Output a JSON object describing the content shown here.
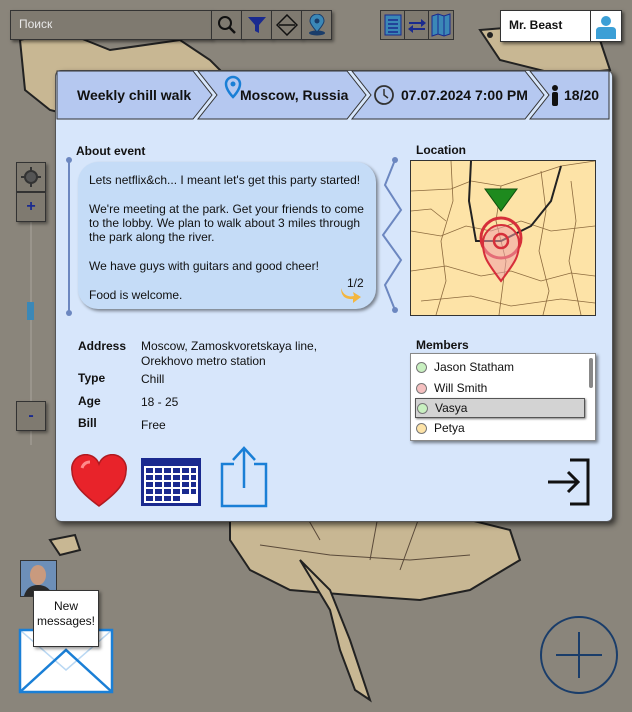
{
  "search": {
    "placeholder": "Поиск"
  },
  "toolbar": {
    "icons": [
      "search-icon",
      "filter-icon",
      "layers-icon",
      "map-pin-icon"
    ],
    "views": [
      "list-view-icon",
      "swap-icon",
      "map-view-icon"
    ]
  },
  "user": {
    "name": "Mr. Beast",
    "avatar_icon": "user-avatar-icon"
  },
  "zoom": {
    "in_label": "+",
    "out_label": "-"
  },
  "event": {
    "title": "Weekly chill walk",
    "location": "Moscow, Russia",
    "datetime": "07.07.2024 7:00 PM",
    "attendance": "18/20",
    "about_title": "About event",
    "about_lines": [
      "Lets netflix&ch... I meant let's get this party started!",
      "We're meeting at the park. Get your friends to come to the lobby. We plan to walk about 3 miles through the park along the river.",
      "We have guys with guitars and good cheer!",
      "Food is welcome."
    ],
    "page_indicator": "1/2",
    "location_title": "Location",
    "details": {
      "address_label": "Address",
      "address_value_line1": "Moscow, Zamoskvoretskaya line,",
      "address_value_line2": "Orekhovo metro station",
      "type_label": "Type",
      "type_value": "Chill",
      "age_label": "Age",
      "age_value": "18 - 25",
      "bill_label": "Bill",
      "bill_value": "Free"
    },
    "members_title": "Members",
    "members": [
      {
        "name": "Jason Statham",
        "status_color": "#c8f0c0"
      },
      {
        "name": "Will Smith",
        "status_color": "#f5c0c0"
      },
      {
        "name": "Vasya",
        "status_color": "#c8f0c0",
        "selected": true
      },
      {
        "name": "Petya",
        "status_color": "#fde3a7"
      }
    ]
  },
  "notification": {
    "line1": "New",
    "line2": "messages!"
  },
  "colors": {
    "card_bg": "#d7e6fb",
    "header_bg": "#b5c8f0",
    "accent_blue": "#1a7fd6",
    "heart_red": "#e8232a",
    "map_bg": "#8a857b"
  }
}
